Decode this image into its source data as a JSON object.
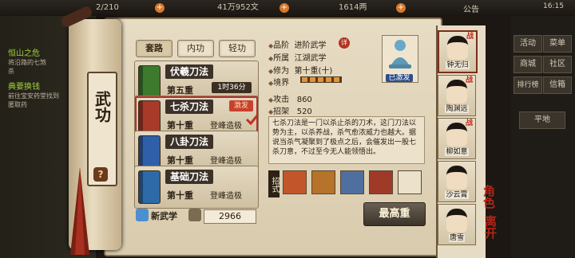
{
  "top_bar": {
    "stamina": "2/210",
    "silver": "41万952文",
    "gold": "1614两",
    "announcement": "公告",
    "time": "16:15"
  },
  "quests": [
    {
      "title": "恒山之危",
      "text": "将沿路的七煞\n杀"
    },
    {
      "title": "典要换钱",
      "text": "前往宝安药堂找到\n匿取药"
    }
  ],
  "right_menu": {
    "activity": "活动",
    "menu": "菜单",
    "shop": "商城",
    "community": "社区",
    "leaderboard": "排行榜",
    "mail": "信箱",
    "location": "平地"
  },
  "panel_title": "武功",
  "help_badge": "?",
  "tabs": [
    "套路",
    "内功",
    "轻功"
  ],
  "skills": [
    {
      "name": "伏羲刀法",
      "level": "第五重",
      "timer": "1时36分",
      "badge": "",
      "color": "#3d7a2d"
    },
    {
      "name": "七杀刀法",
      "level": "第十重",
      "sub": "登峰造极",
      "badge": "激发",
      "color": "#a83a2a",
      "selected": true
    },
    {
      "name": "八卦刀法",
      "level": "第十重",
      "sub": "登峰造极",
      "badge": "",
      "color": "#2f5fa8"
    },
    {
      "name": "基础刀法",
      "level": "第十重",
      "sub": "登峰造极",
      "badge": "",
      "color": "#2f6aa8"
    }
  ],
  "new_skill": {
    "label": "新武学",
    "count": "2966"
  },
  "detail": {
    "grade_label": "品阶",
    "grade_value": "进阶武学",
    "grade_badge": "详",
    "faction_label": "所属",
    "faction_value": "江湖武学",
    "cultivation_label": "修为",
    "cultivation_value": "第十重(十)",
    "realm_label": "境界",
    "realm_segments": 5,
    "learned_tag": "已激发",
    "attack_label": "攻击",
    "attack_value": "860",
    "parry_label": "招架",
    "parry_value": "520",
    "description": "七杀刀法是一门以杀止杀的刀术，这门刀法以势为主，以杀养战，杀气愈浓威力也越大。据说当杀气凝聚到了极点之后，会催发出一股七杀刀意，不过至今无人能领悟出。",
    "moves_label": "招式",
    "moves": [
      {
        "icon": "slash-icon",
        "color": "#c2562a"
      },
      {
        "icon": "whirl-icon",
        "color": "#b5742a"
      },
      {
        "icon": "warrior-icon",
        "color": "#4f6fa0"
      },
      {
        "icon": "blade-icon",
        "color": "#a03a28"
      },
      {
        "icon": "empty-slot",
        "color": "#ece2cc"
      }
    ],
    "max_button": "最高重"
  },
  "characters": [
    {
      "name": "钟无归",
      "badge": "战"
    },
    {
      "name": "陶渊远",
      "badge": "战"
    },
    {
      "name": "柳如意",
      "badge": "战"
    },
    {
      "name": "沙云霄",
      "badge": ""
    },
    {
      "name": "唐雪",
      "badge": ""
    }
  ],
  "role_label": "角色",
  "leave_label": "离开"
}
